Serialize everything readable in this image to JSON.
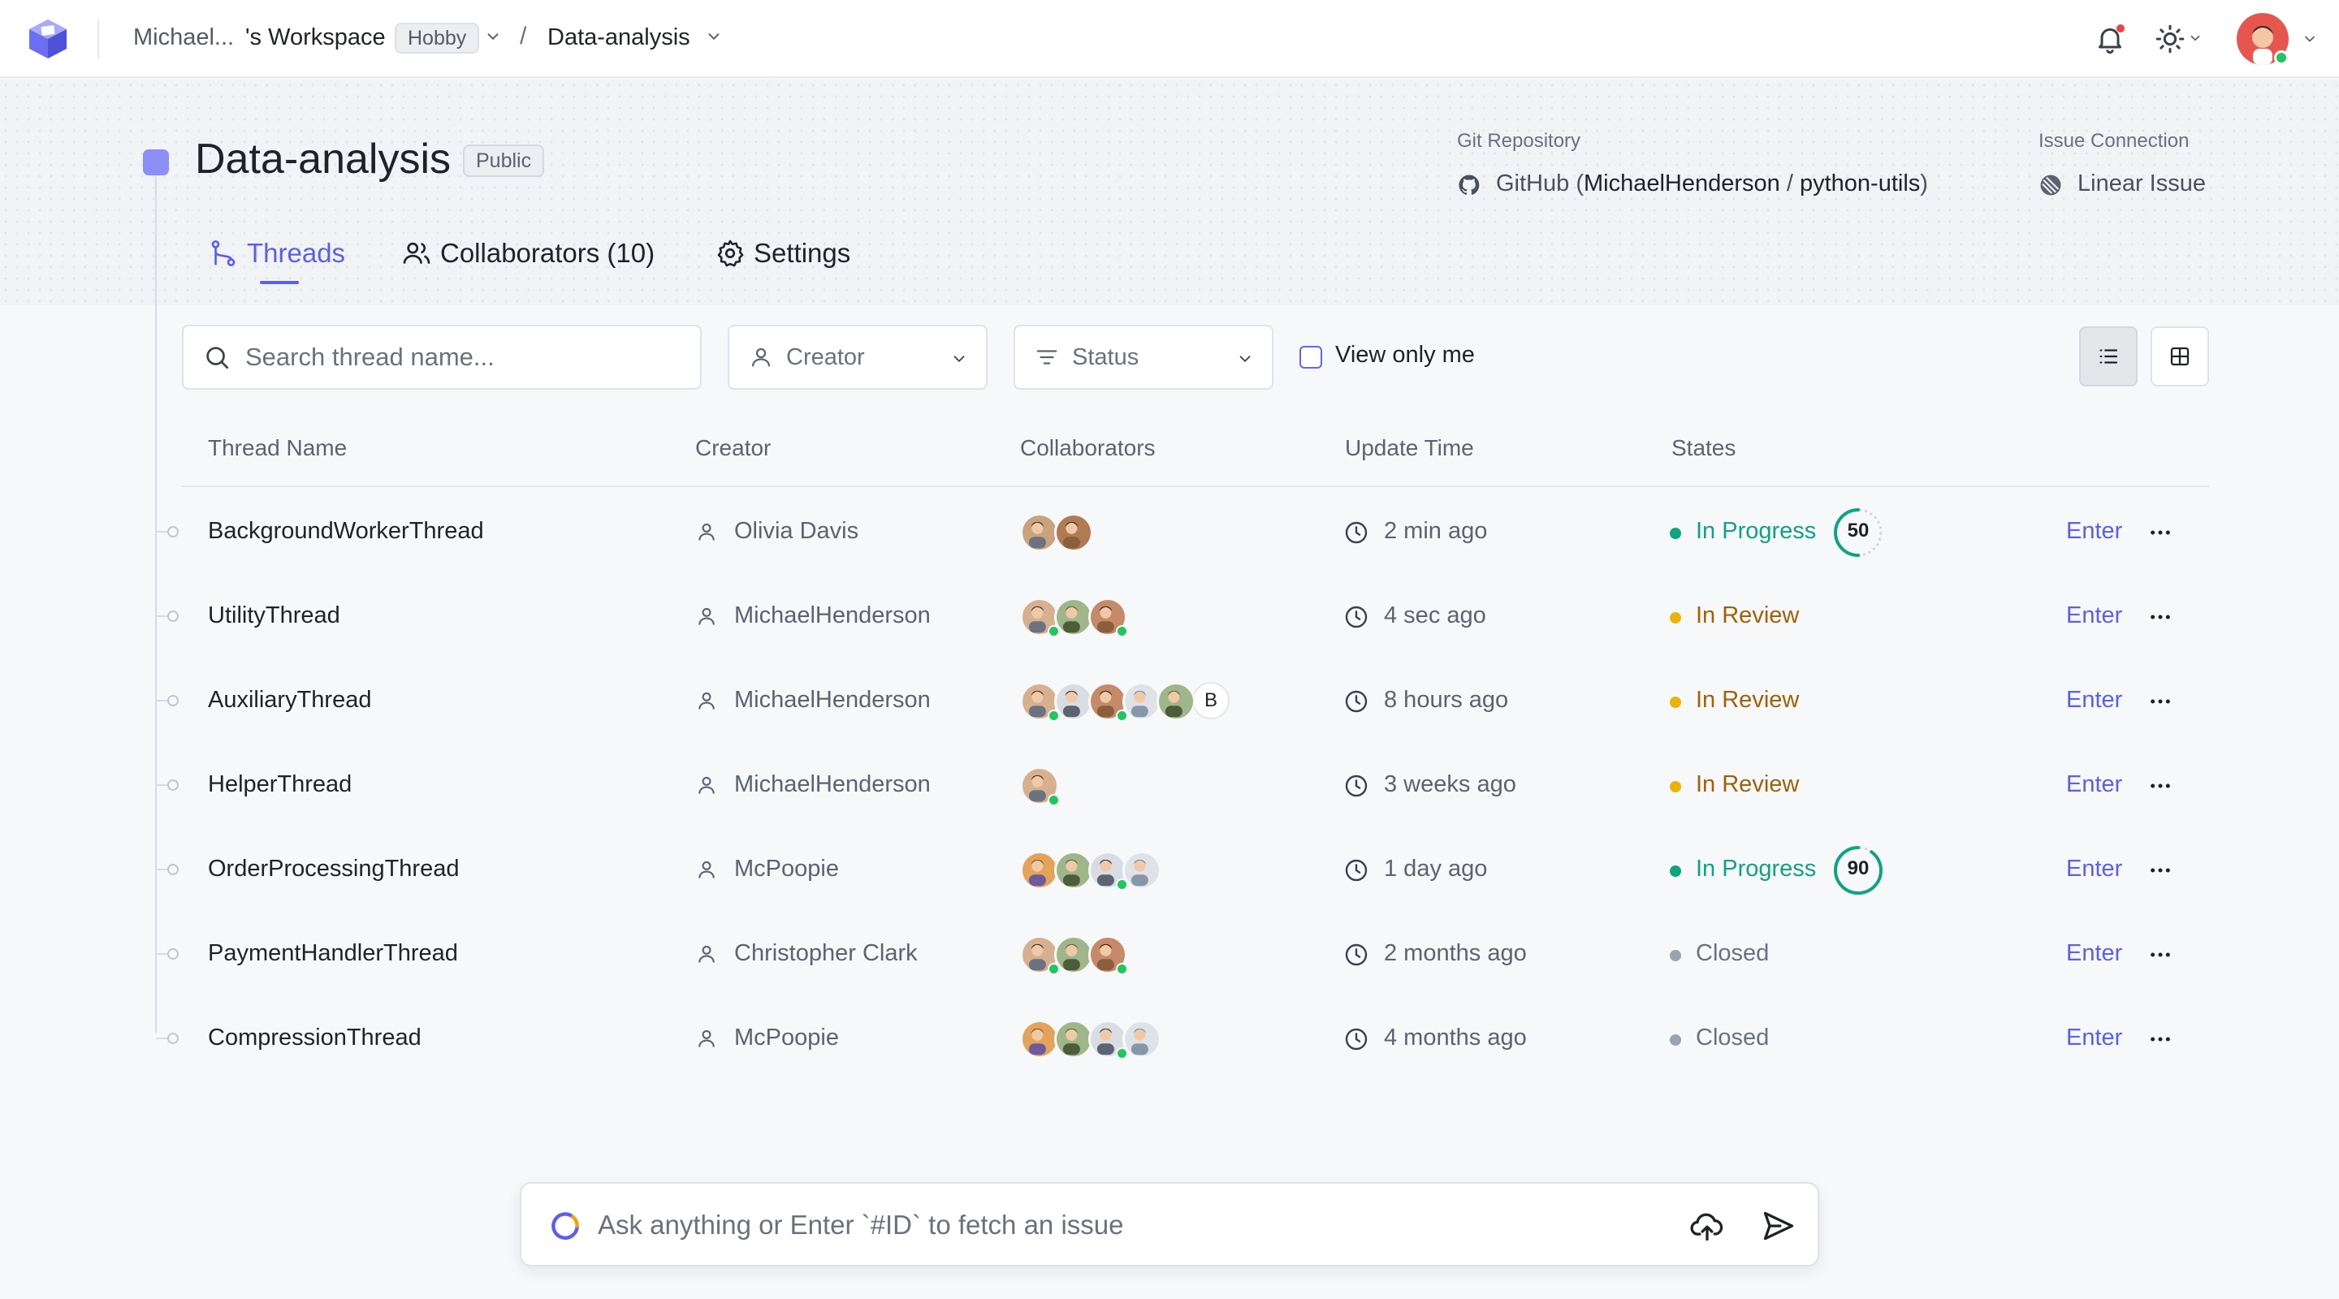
{
  "topbar": {
    "workspace_owner": "Michael...",
    "workspace_suffix": "'s Workspace",
    "plan_badge": "Hobby",
    "breadcrumb_sep": "/",
    "project": "Data-analysis"
  },
  "project": {
    "title": "Data-analysis",
    "visibility": "Public",
    "git_label": "Git Repository",
    "git_provider": "GitHub",
    "git_owner": "MichaelHenderson",
    "git_sep": "/",
    "git_repo": "python-utils",
    "issue_label": "Issue Connection",
    "issue_value": "Linear Issue"
  },
  "tabs": [
    {
      "label": "Threads",
      "active": true
    },
    {
      "label": "Collaborators (10)",
      "active": false
    },
    {
      "label": "Settings",
      "active": false
    }
  ],
  "filters": {
    "search_placeholder": "Search thread name...",
    "creator_label": "Creator",
    "status_label": "Status",
    "view_only_me": "View only me"
  },
  "table": {
    "headers": [
      "Thread Name",
      "Creator",
      "Collaborators",
      "Update Time",
      "States"
    ],
    "enter_label": "Enter",
    "rows": [
      {
        "name": "BackgroundWorkerThread",
        "creator": "Olivia Davis",
        "time": "2 min ago",
        "state": "In Progress",
        "progress": 50
      },
      {
        "name": "UtilityThread",
        "creator": "MichaelHenderson",
        "time": "4 sec ago",
        "state": "In Review"
      },
      {
        "name": "AuxiliaryThread",
        "creator": "MichaelHenderson",
        "time": "8 hours ago",
        "state": "In Review",
        "extra_letter": "B"
      },
      {
        "name": "HelperThread",
        "creator": "MichaelHenderson",
        "time": "3 weeks ago",
        "state": "In Review"
      },
      {
        "name": "OrderProcessingThread",
        "creator": "McPoopie",
        "time": "1 day ago",
        "state": "In Progress",
        "progress": 90
      },
      {
        "name": "PaymentHandlerThread",
        "creator": "Christopher Clark",
        "time": "2 months ago",
        "state": "Closed"
      },
      {
        "name": "CompressionThread",
        "creator": "McPoopie",
        "time": "4 months ago",
        "state": "Closed"
      }
    ]
  },
  "prompt": {
    "placeholder": "Ask anything or Enter `#ID` to fetch an issue"
  },
  "colors": {
    "accent": "#5b5ff0",
    "in_progress": "#10a37f",
    "in_review": "#a16207",
    "in_review_dot": "#eab308",
    "closed": "#6b717c",
    "online": "#22c55e"
  }
}
